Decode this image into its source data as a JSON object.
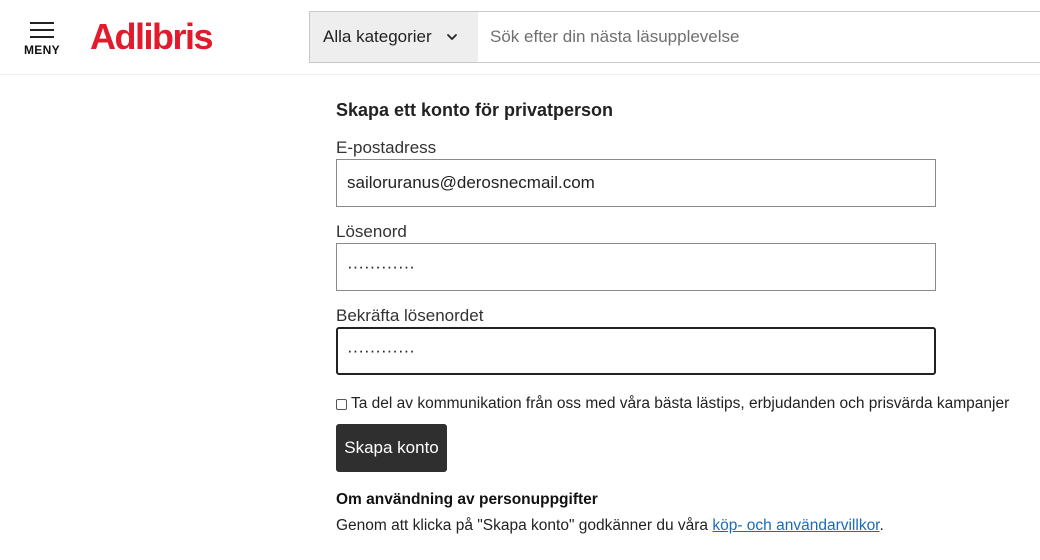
{
  "header": {
    "menu_label": "MENY",
    "logo_text": "Adlibris",
    "logo_color": "#e3192c",
    "category_label": "Alla kategorier",
    "search_placeholder": "Sök efter din nästa läsupplevelse"
  },
  "form": {
    "title": "Skapa ett konto för privatperson",
    "email_label": "E-postadress",
    "email_value": "sailoruranus@derosnecmail.com",
    "password_label": "Lösenord",
    "password_value": "············",
    "confirm_label": "Bekräfta lösenordet",
    "confirm_value": "············",
    "newsletter_label": "Ta del av kommunikation från oss med våra bästa lästips, erbjudanden och prisvärda kampanjer",
    "newsletter_checked": false,
    "submit_label": "Skapa konto"
  },
  "privacy": {
    "title": "Om användning av personuppgifter",
    "text_prefix": "Genom att klicka på \"Skapa konto\" godkänner du våra ",
    "link_text": "köp- och användarvillkor",
    "text_suffix": "."
  },
  "colors": {
    "button_bg": "#2f2f2f",
    "link": "#1a6bb8"
  }
}
